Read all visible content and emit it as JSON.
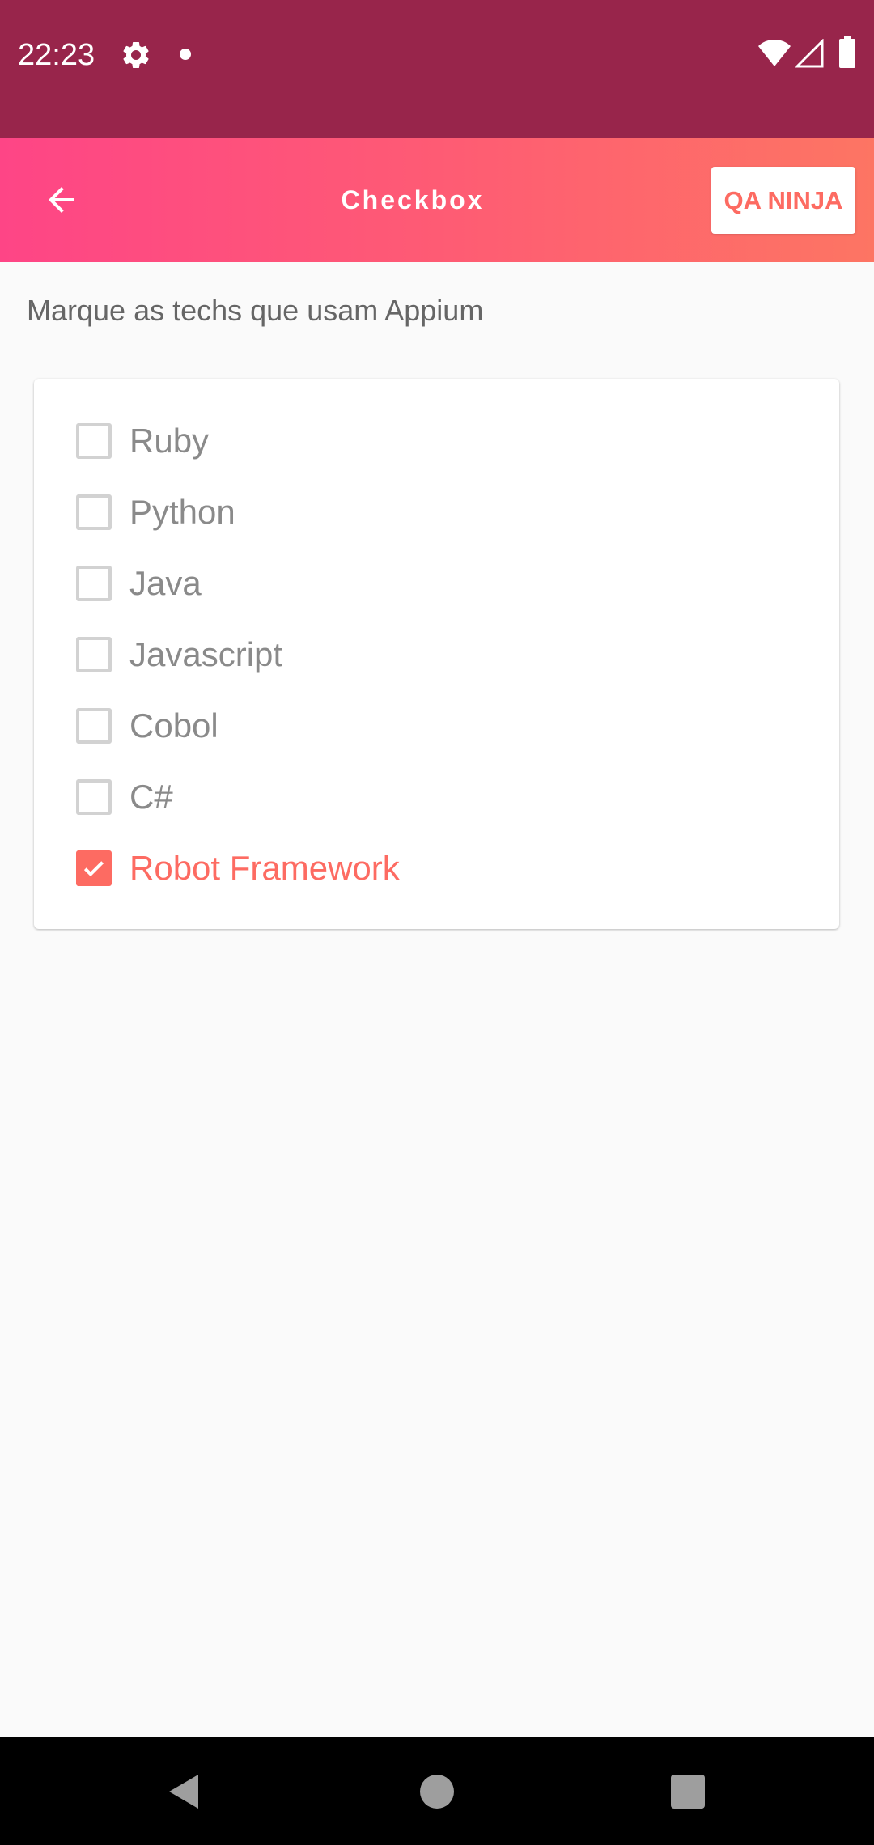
{
  "status_bar": {
    "time": "22:23",
    "icons": [
      "gear-icon",
      "notification-dot-icon",
      "wifi-icon",
      "signal-icon",
      "battery-icon"
    ]
  },
  "app_bar": {
    "title": "Checkbox",
    "back_icon": "arrow-left-icon",
    "action_label": "QA NINJA",
    "gradient": [
      "#fe4586",
      "#fd7563"
    ]
  },
  "content": {
    "prompt": "Marque as techs que usam Appium",
    "options": [
      {
        "label": "Ruby",
        "checked": false
      },
      {
        "label": "Python",
        "checked": false
      },
      {
        "label": "Java",
        "checked": false
      },
      {
        "label": "Javascript",
        "checked": false
      },
      {
        "label": "Cobol",
        "checked": false
      },
      {
        "label": "C#",
        "checked": false
      },
      {
        "label": "Robot Framework",
        "checked": true
      }
    ]
  },
  "nav_bar": {
    "icons": [
      "nav-back-icon",
      "nav-home-icon",
      "nav-recents-icon"
    ]
  },
  "colors": {
    "status_bar": "#98254b",
    "accent": "#fd6b62",
    "unchecked_border": "#d2d2d2",
    "label_text": "#8a8a8a"
  }
}
